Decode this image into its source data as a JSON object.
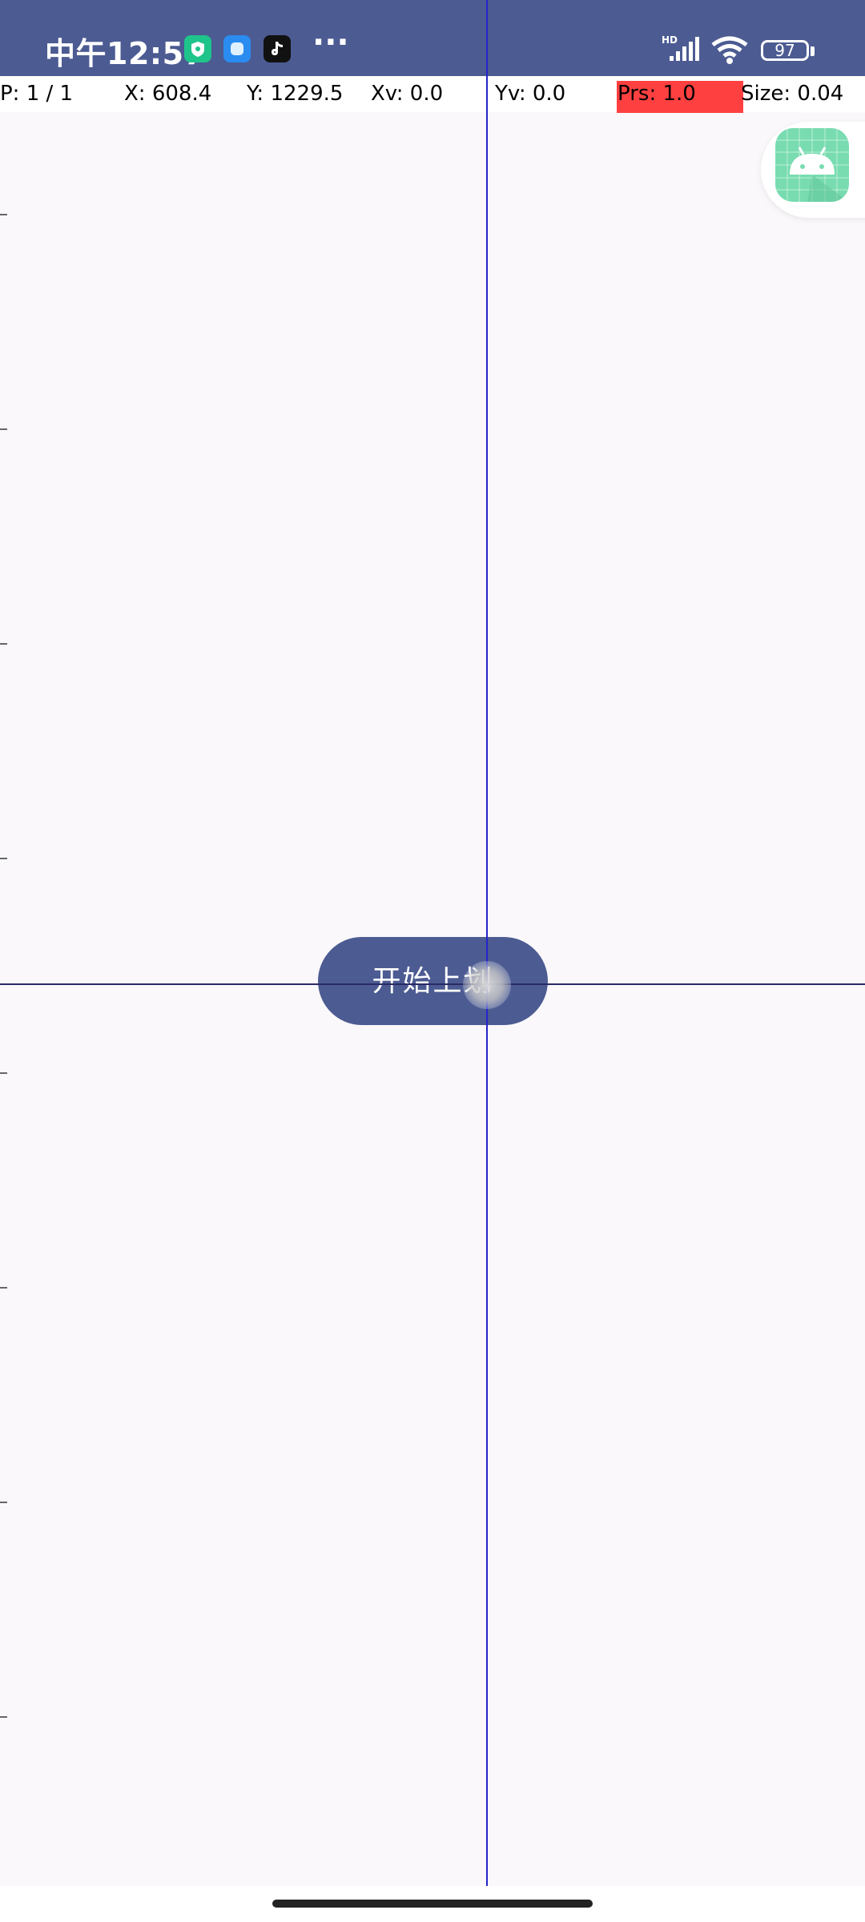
{
  "status_bar": {
    "time": "中午12:57",
    "app_icons": [
      "shield-app-icon",
      "blue-app-icon",
      "tiktok-icon"
    ],
    "more": "···",
    "battery": "97",
    "network": "HD"
  },
  "pointer_info": {
    "p": "P: 1 / 1",
    "x": "X: 608.4",
    "y": "Y: 1229.5",
    "xv": "Xv: 0.0",
    "yv": "Yv: 0.0",
    "prs": "Prs: 1.0",
    "size": "Size: 0.04"
  },
  "main": {
    "button_label": "开始上划"
  },
  "colors": {
    "accent": "#4c5b92",
    "pressure_highlight": "#ff4040",
    "crosshair_vertical": "#2424c8"
  },
  "floating_bubble": {
    "icon": "android-icon"
  }
}
